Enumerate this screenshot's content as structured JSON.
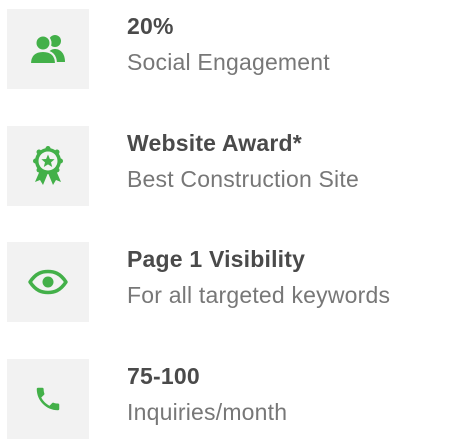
{
  "theme": {
    "accent": "#43b049",
    "icon_bg": "#f2f2f2",
    "value_color": "#4a4a4a",
    "label_color": "#777777"
  },
  "stats": [
    {
      "icon": "users-icon",
      "value": "20%",
      "label": "Social Engagement"
    },
    {
      "icon": "award-ribbon-icon",
      "value": "Website Award*",
      "label": "Best Construction Site"
    },
    {
      "icon": "eye-icon",
      "value": "Page 1 Visibility",
      "label": "For all targeted keywords"
    },
    {
      "icon": "phone-icon",
      "value": "75-100",
      "label": "Inquiries/month"
    }
  ]
}
